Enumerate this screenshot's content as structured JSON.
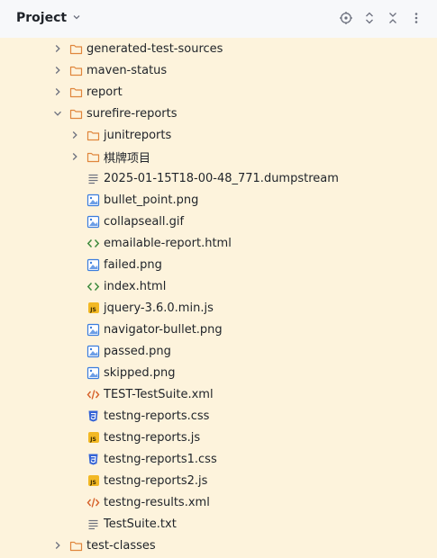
{
  "header": {
    "title": "Project",
    "actions": [
      "locate-icon",
      "expand-icon",
      "collapse-icon",
      "more-icon"
    ]
  },
  "tree": {
    "rows": [
      {
        "label": "generated-test-sources",
        "type": "folder",
        "expanded": false
      },
      {
        "label": "maven-status",
        "type": "folder",
        "expanded": false
      },
      {
        "label": "report",
        "type": "folder",
        "expanded": false
      },
      {
        "label": "surefire-reports",
        "type": "folder",
        "expanded": true
      },
      {
        "label": "junitreports",
        "type": "folder",
        "expanded": false
      },
      {
        "label": "棋牌项目",
        "type": "folder",
        "expanded": false
      },
      {
        "label": "2025-01-15T18-00-48_771.dumpstream",
        "type": "text"
      },
      {
        "label": "bullet_point.png",
        "type": "image"
      },
      {
        "label": "collapseall.gif",
        "type": "image"
      },
      {
        "label": "emailable-report.html",
        "type": "html"
      },
      {
        "label": "failed.png",
        "type": "image"
      },
      {
        "label": "index.html",
        "type": "html"
      },
      {
        "label": "jquery-3.6.0.min.js",
        "type": "js"
      },
      {
        "label": "navigator-bullet.png",
        "type": "image"
      },
      {
        "label": "passed.png",
        "type": "image"
      },
      {
        "label": "skipped.png",
        "type": "image"
      },
      {
        "label": "TEST-TestSuite.xml",
        "type": "xml"
      },
      {
        "label": "testng-reports.css",
        "type": "css"
      },
      {
        "label": "testng-reports.js",
        "type": "js"
      },
      {
        "label": "testng-reports1.css",
        "type": "css"
      },
      {
        "label": "testng-reports2.js",
        "type": "js"
      },
      {
        "label": "testng-results.xml",
        "type": "xml"
      },
      {
        "label": "TestSuite.txt",
        "type": "text"
      },
      {
        "label": "test-classes",
        "type": "folder",
        "expanded": false
      }
    ]
  },
  "colors": {
    "tree_background": "#fdf3dc",
    "folder": "#e0863c",
    "image": "#3b7ddd",
    "html": "#3d8a3d",
    "xml": "#d6612a",
    "css": "#3564d6",
    "js": "#f2b824"
  }
}
